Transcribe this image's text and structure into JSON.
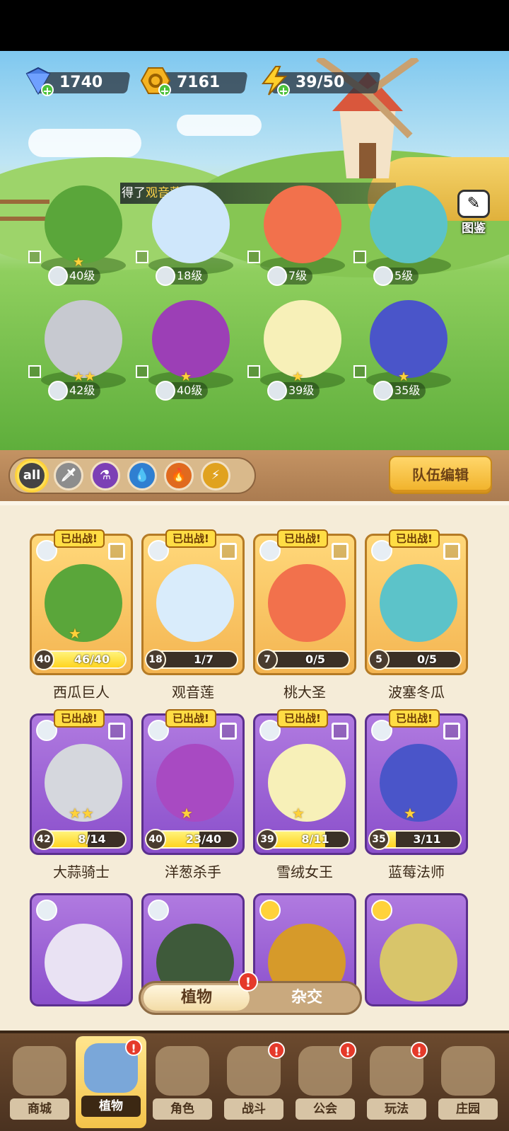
{
  "resources": {
    "gems": "1740",
    "coins": "7161",
    "energy": "39/50"
  },
  "notice": {
    "prefix": "得了",
    "highlight": "观音莲",
    "suffix": "!"
  },
  "codex_label": "图鉴",
  "scene_pets": [
    {
      "level": "40级",
      "element": "sword-icon",
      "stars": "★",
      "color": "#5aa63a"
    },
    {
      "level": "18级",
      "element": "water-drop-icon",
      "stars": "",
      "color": "#cfe7fb"
    },
    {
      "level": "7级",
      "element": "sword-icon",
      "stars": "",
      "color": "#f2714c"
    },
    {
      "level": "5级",
      "element": "water-drop-icon",
      "stars": "",
      "color": "#5cc3c9"
    },
    {
      "level": "42级",
      "element": "potion-icon",
      "stars": "★★",
      "color": "#c7c9d0"
    },
    {
      "level": "40级",
      "element": "potion-icon",
      "stars": "★",
      "color": "#9c3fb6"
    },
    {
      "level": "39级",
      "element": "water-drop-icon",
      "stars": "★",
      "color": "#f7f0b8"
    },
    {
      "level": "35级",
      "element": "water-drop-icon",
      "stars": "★",
      "color": "#4a55c9"
    }
  ],
  "filters": [
    "all",
    "sword",
    "potion",
    "water",
    "fire",
    "lightning"
  ],
  "team_edit_label": "队伍编辑",
  "deployed_label": "已出战!",
  "cards": [
    {
      "name": "西瓜巨人",
      "level": "40",
      "progress": "46/40",
      "fill": 1.0,
      "stars": "★",
      "rarity": "gold",
      "color": "#5aa63a"
    },
    {
      "name": "观音莲",
      "level": "18",
      "progress": "1/7",
      "fill": 0.14,
      "stars": "",
      "rarity": "gold",
      "color": "#d9ecfb"
    },
    {
      "name": "桃大圣",
      "level": "7",
      "progress": "0/5",
      "fill": 0.0,
      "stars": "",
      "rarity": "gold",
      "color": "#f2714c"
    },
    {
      "name": "波塞冬瓜",
      "level": "5",
      "progress": "0/5",
      "fill": 0.0,
      "stars": "",
      "rarity": "gold",
      "color": "#5cc3c9"
    },
    {
      "name": "大蒜骑士",
      "level": "42",
      "progress": "8/14",
      "fill": 0.57,
      "stars": "★★",
      "rarity": "purple",
      "color": "#d5d7dd"
    },
    {
      "name": "洋葱杀手",
      "level": "40",
      "progress": "23/40",
      "fill": 0.57,
      "stars": "★",
      "rarity": "purple",
      "color": "#a84ac2"
    },
    {
      "name": "雪绒女王",
      "level": "39",
      "progress": "8/11",
      "fill": 0.73,
      "stars": "★",
      "rarity": "purple",
      "color": "#f7f0b8"
    },
    {
      "name": "蓝莓法师",
      "level": "35",
      "progress": "3/11",
      "fill": 0.27,
      "stars": "★",
      "rarity": "purple",
      "color": "#4a55c9"
    }
  ],
  "tabs": {
    "plants": "植物",
    "hybrid": "杂交",
    "alert": "!"
  },
  "nav": [
    {
      "label": "商城",
      "icon": "shop-icon",
      "badge": ""
    },
    {
      "label": "植物",
      "icon": "plants-icon",
      "badge": "!"
    },
    {
      "label": "角色",
      "icon": "character-icon",
      "badge": ""
    },
    {
      "label": "战斗",
      "icon": "battle-icon",
      "badge": "!"
    },
    {
      "label": "公会",
      "icon": "guild-icon",
      "badge": "!"
    },
    {
      "label": "玩法",
      "icon": "gameplay-icon",
      "badge": "!"
    },
    {
      "label": "庄园",
      "icon": "manor-lock-icon",
      "badge": ""
    }
  ]
}
